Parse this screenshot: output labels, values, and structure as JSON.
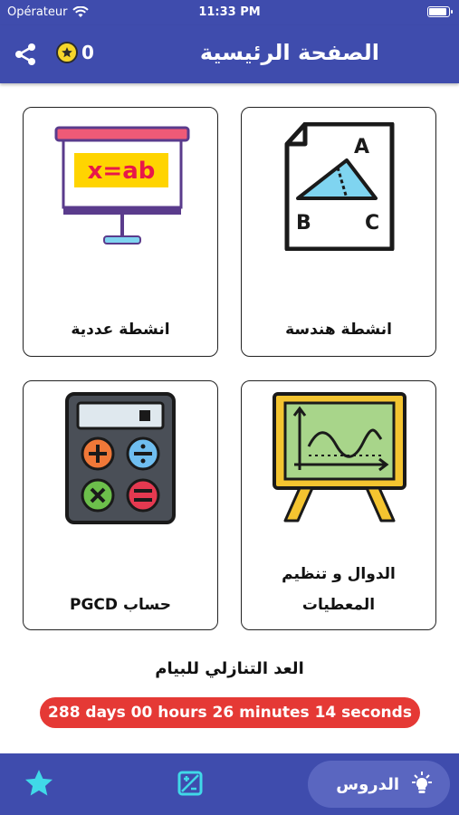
{
  "status_bar": {
    "carrier": "Opérateur",
    "time": "11:33 PM"
  },
  "header": {
    "title": "الصفحة الرئيسية",
    "points": "0"
  },
  "cards": [
    {
      "label": "انشطة هندسة",
      "icon": "triangle-abc-icon"
    },
    {
      "label": "انشطة عددية",
      "icon": "projector-equation-icon",
      "equation": "x=ab"
    },
    {
      "label_line1": "الدوال و تنظيم",
      "label_line2": "المعطيات",
      "icon": "function-graph-board-icon"
    },
    {
      "label": "حساب PGCD",
      "icon": "calculator-icon"
    }
  ],
  "geometry_icon_letters": {
    "a": "A",
    "b": "B",
    "c": "C"
  },
  "countdown": {
    "title": "العد التنازلي للبيام",
    "value": "288 days 00 hours 26 minutes 14 seconds"
  },
  "tab_bar": {
    "lessons_label": "الدروس"
  },
  "colors": {
    "primary": "#3f4cad",
    "accent_red": "#e53935",
    "tab_active": "#5a66c0",
    "star_cyan": "#40d9e8"
  }
}
